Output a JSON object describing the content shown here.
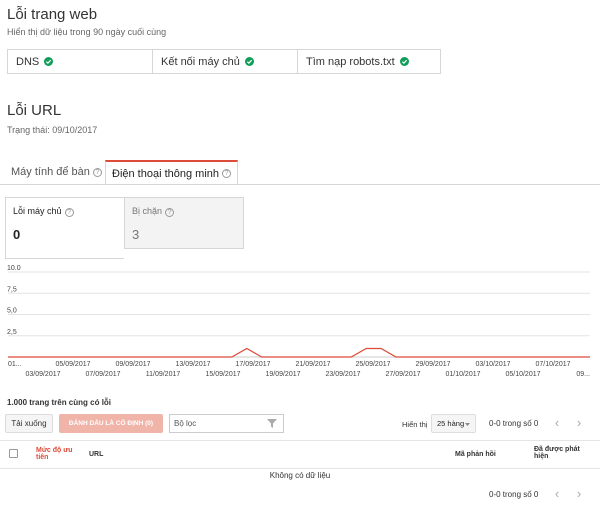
{
  "crawl_errors": {
    "title": "Lỗi trang web",
    "subtitle": "Hiển thị dữ liệu trong 90 ngày cuối cùng",
    "checks": [
      {
        "label": "DNS"
      },
      {
        "label": "Kết nối máy chủ"
      },
      {
        "label": "Tìm nạp robots.txt"
      }
    ],
    "check_color": "#0f9d58"
  },
  "url_errors": {
    "title": "Lỗi URL",
    "status": "Trạng thái: 09/10/2017"
  },
  "tabs": [
    {
      "label": "Máy tính để bàn",
      "active": false
    },
    {
      "label": "Điện thoại thông minh",
      "active": true
    }
  ],
  "cards": [
    {
      "label": "Lỗi máy chủ",
      "count": "0",
      "selected": true
    },
    {
      "label": "Bị chặn",
      "count": "3",
      "selected": false
    }
  ],
  "chart_data": {
    "type": "line",
    "ylim": [
      0,
      10
    ],
    "yticks": [
      "10.0",
      "7,5",
      "5,0",
      "2,5"
    ],
    "xticks_top": [
      "01...",
      "05/09/2017",
      "09/09/2017",
      "13/09/2017",
      "17/09/2017",
      "21/09/2017",
      "25/09/2017",
      "29/09/2017",
      "03/10/2017",
      "07/10/2017"
    ],
    "xticks_bottom": [
      "03/09/2017",
      "07/09/2017",
      "11/09/2017",
      "15/09/2017",
      "19/09/2017",
      "23/09/2017",
      "27/09/2017",
      "01/10/2017",
      "05/10/2017",
      "09..."
    ],
    "x": [
      "01/09/2017",
      "02/09/2017",
      "03/09/2017",
      "04/09/2017",
      "05/09/2017",
      "06/09/2017",
      "07/09/2017",
      "08/09/2017",
      "09/09/2017",
      "10/09/2017",
      "11/09/2017",
      "12/09/2017",
      "13/09/2017",
      "14/09/2017",
      "15/09/2017",
      "16/09/2017",
      "17/09/2017",
      "18/09/2017",
      "19/09/2017",
      "20/09/2017",
      "21/09/2017",
      "22/09/2017",
      "23/09/2017",
      "24/09/2017",
      "25/09/2017",
      "26/09/2017",
      "27/09/2017",
      "28/09/2017",
      "29/09/2017",
      "30/09/2017",
      "01/10/2017",
      "02/10/2017",
      "03/10/2017",
      "04/10/2017",
      "05/10/2017",
      "06/10/2017",
      "07/10/2017",
      "08/10/2017",
      "09/10/2017",
      "10/10/2017"
    ],
    "series": [
      {
        "values": [
          0,
          0,
          0,
          0,
          0,
          0,
          0,
          0,
          0,
          0,
          0,
          0,
          0,
          0,
          0,
          0,
          1,
          0,
          0,
          0,
          0,
          0,
          0,
          0,
          1,
          1,
          0,
          0,
          0,
          0,
          0,
          0,
          0,
          0,
          0,
          0,
          0,
          0,
          0,
          0
        ],
        "color": "#dd4b39"
      }
    ]
  },
  "table": {
    "summary": "1.000 trang trên cùng có lỗi",
    "download_label": "Tải xuống",
    "mark_fixed_label": "ĐÁNH DẤU LÀ CỐ ĐỊNH (0)",
    "filter_placeholder": "Bộ lọc",
    "show_label": "Hiển thị",
    "rows_select": "25 hàng",
    "pagination": "0-0 trong số 0",
    "columns": {
      "priority": "Mức độ ưu tiên",
      "url": "URL",
      "response_code": "Mã phản hồi",
      "detected": "Đã được phát hiện"
    },
    "empty": "Không có dữ liệu"
  },
  "accent_color": "#dd4b39"
}
